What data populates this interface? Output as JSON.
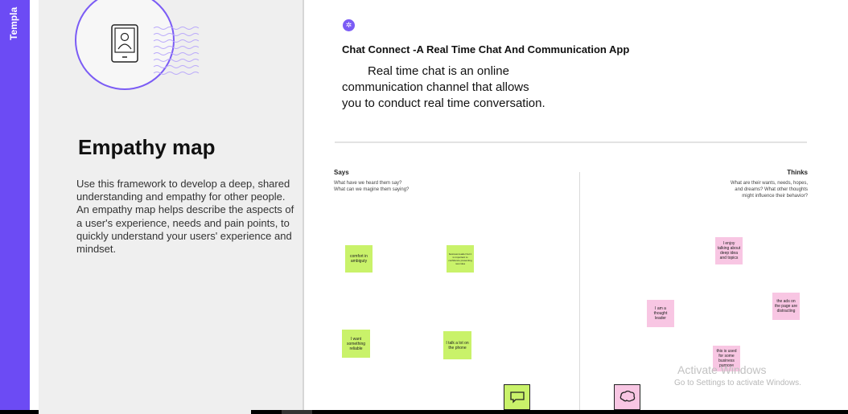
{
  "template_strip": {
    "label": "Templa"
  },
  "info_panel": {
    "title": "Empathy map",
    "description": "Use this framework to develop a deep, shared understanding and empathy for other people. An empathy map helps describe the aspects of a user's experience, needs and pain points, to quickly understand your users' experience and mindset.",
    "hero_icon": "profile-card-icon"
  },
  "canvas": {
    "sparkle_icon": "✲",
    "app_title": "Chat Connect -A Real Time Chat And Communication App",
    "app_desc_lines": [
      "Real time chat is an  online",
      "communication channel  that allows",
      "you to conduct real time conversation."
    ],
    "says": {
      "title": "Says",
      "questions": [
        "What have we heard them say?",
        "What can we magine them saying?"
      ]
    },
    "thinks": {
      "title": "Thinks",
      "questions": [
        "What are their wants, needs, hopes,",
        "and dreams? What other thoughts",
        "might influence their behavior?"
      ]
    },
    "stickies_green": [
      "comfort in ambiguty",
      "business leader but it is important to confidence presenting new idea",
      "I want something reliable",
      "I talk a lot on the phone"
    ],
    "stickies_pink": [
      "I enjoy talking about deep idea and topics",
      "I am a thought leader",
      "the ads on the page are distracting",
      "this is used for some business purpose"
    ],
    "tools": [
      "comment-icon",
      "thought-bubble-icon"
    ]
  },
  "watermark": {
    "line1": "Activate Windows",
    "line2": "Go to Settings to activate Windows."
  },
  "colors": {
    "accent": "#6c4bf4",
    "sticky_green": "#c9f26a",
    "sticky_pink": "#f8c6e3"
  }
}
